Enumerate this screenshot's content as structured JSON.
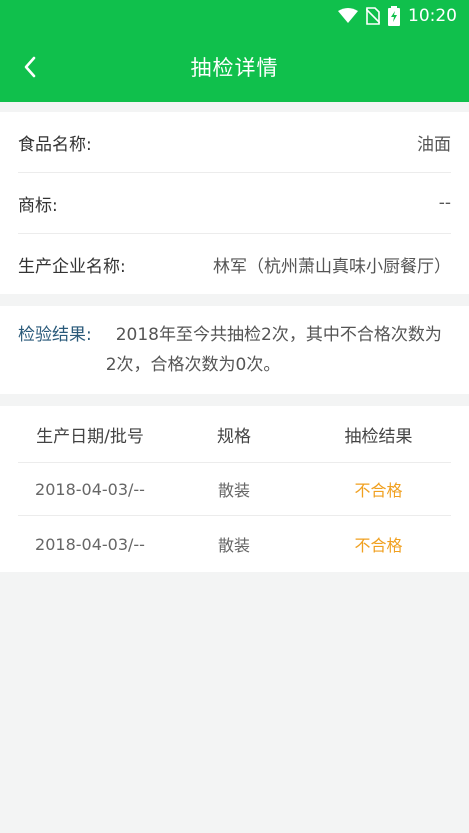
{
  "status_bar": {
    "time": "10:20"
  },
  "header": {
    "title": "抽检详情"
  },
  "info": {
    "rows": [
      {
        "label": "食品名称:",
        "value": "油面"
      },
      {
        "label": "商标:",
        "value": "--"
      },
      {
        "label": "生产企业名称:",
        "value": "林军（杭州萧山真味小厨餐厅）"
      }
    ]
  },
  "result": {
    "label": "检验结果:",
    "text": "2018年至今共抽检2次，其中不合格次数为2次，合格次数为0次。"
  },
  "table": {
    "headers": [
      "生产日期/批号",
      "规格",
      "抽检结果"
    ],
    "rows": [
      {
        "date": "2018-04-03/--",
        "spec": "散装",
        "result": "不合格"
      },
      {
        "date": "2018-04-03/--",
        "spec": "散装",
        "result": "不合格"
      }
    ]
  },
  "colors": {
    "brand": "#10c04c",
    "fail": "#f0a020"
  }
}
